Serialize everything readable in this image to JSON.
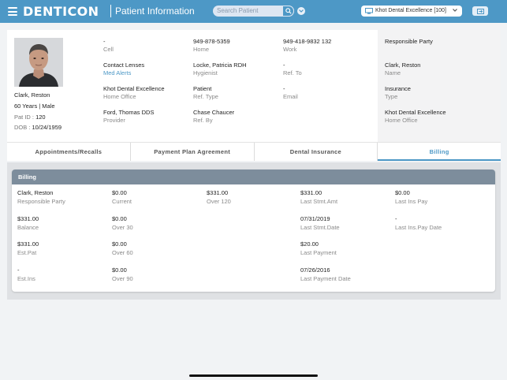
{
  "header": {
    "logo": "DENTICON",
    "page_title": "Patient Information",
    "search_placeholder": "Search Patient",
    "office": "Khot Dental Excellence [100]",
    "brand_color": "#4d98c6"
  },
  "patient": {
    "name": "Clark, Reston",
    "age_gender": "60 Years | Male",
    "id_label": "Pat ID : ",
    "id_value": "120",
    "dob_label": "DOB : ",
    "dob_value": "10/24/1959"
  },
  "fields": [
    {
      "value": "-",
      "label": "Cell"
    },
    {
      "value": "949-878-5359",
      "label": "Home"
    },
    {
      "value": "949-418-9832 132",
      "label": "Work"
    },
    {
      "value": "Contact Lenses",
      "label": "Med Alerts"
    },
    {
      "value": "Locke, Patricia RDH",
      "label": "Hygienist"
    },
    {
      "value": "-",
      "label": "Ref. To"
    },
    {
      "value": "Khot Dental Excellence",
      "label": "Home Office"
    },
    {
      "value": "Patient",
      "label": "Ref. Type"
    },
    {
      "value": "-",
      "label": "Email"
    },
    {
      "value": "Ford, Thomas DDS",
      "label": "Provider"
    },
    {
      "value": "Chase Chaucer",
      "label": "Ref. By"
    }
  ],
  "responsible": {
    "title": "Responsible Party",
    "name": "Clark, Reston",
    "name_label": "Name",
    "insurance_title": "Insurance",
    "type_label": "Type",
    "office": "Khot Dental Excellence",
    "office_label": "Home Office"
  },
  "tabs": [
    {
      "label": "Appointments/Recalls",
      "active": false
    },
    {
      "label": "Payment Plan Agreement",
      "active": false
    },
    {
      "label": "Dental Insurance",
      "active": false
    },
    {
      "label": "Billing",
      "active": true
    }
  ],
  "billing": {
    "title": "Billing",
    "fields": [
      {
        "value": "Clark, Reston",
        "label": "Responsible Party"
      },
      {
        "value": "$0.00",
        "label": "Current"
      },
      {
        "value": "$331.00",
        "label": "Over 120"
      },
      {
        "value": "$331.00",
        "label": "Last Stmt.Amt"
      },
      {
        "value": "$0.00",
        "label": "Last Ins Pay"
      },
      {
        "value": "$331.00",
        "label": "Balance"
      },
      {
        "value": "$0.00",
        "label": "Over 30"
      },
      {
        "value": "07/31/2019",
        "label": "Last Stmt.Date"
      },
      {
        "value": "-",
        "label": "Last Ins.Pay Date"
      },
      {
        "value": "$331.00",
        "label": "Est.Pat"
      },
      {
        "value": "$0.00",
        "label": "Over 60"
      },
      {
        "value": "$20.00",
        "label": "Last Payment"
      },
      {
        "value": "-",
        "label": "Est.Ins"
      },
      {
        "value": "$0.00",
        "label": "Over 90"
      },
      {
        "value": "07/26/2016",
        "label": "Last Payment Date"
      }
    ]
  }
}
